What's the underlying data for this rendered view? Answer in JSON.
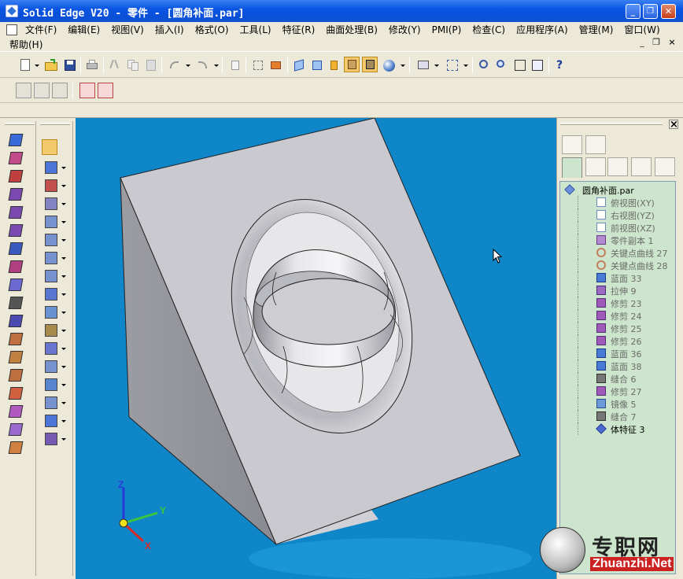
{
  "window": {
    "title": "Solid Edge V20 - 零件 - [圆角补面.par]",
    "minimize": "_",
    "restore": "❐",
    "close": "✕"
  },
  "menu": {
    "items": [
      "文件(F)",
      "编辑(E)",
      "视图(V)",
      "插入(I)",
      "格式(O)",
      "工具(L)",
      "特征(R)",
      "曲面处理(B)",
      "修改(Y)",
      "PMI(P)",
      "检查(C)",
      "应用程序(A)",
      "管理(M)",
      "窗口(W)"
    ],
    "help": "帮助(H)",
    "mdi_min": "_",
    "mdi_restore": "❐",
    "mdi_close": "×"
  },
  "toolbar_icons": [
    "new-icon",
    "open-icon",
    "save-icon",
    "print-icon",
    "cut-icon",
    "copy-icon",
    "paste-icon",
    "undo-icon",
    "redo-icon",
    "select-icon",
    "view-icons",
    "shading-icons",
    "zoom-icons",
    "whats-this-icon"
  ],
  "feature_panel": {
    "close": "×"
  },
  "tree": {
    "root": "圆角补面.par",
    "nodes": [
      {
        "label": "俯视图(XY)",
        "icon": "plane-icon"
      },
      {
        "label": "右视图(YZ)",
        "icon": "plane-icon"
      },
      {
        "label": "前视图(XZ)",
        "icon": "plane-icon"
      },
      {
        "label": "零件副本 1",
        "icon": "part-copy-icon"
      },
      {
        "label": "关键点曲线 27",
        "icon": "keypoint-curve-icon"
      },
      {
        "label": "关键点曲线 28",
        "icon": "keypoint-curve-icon"
      },
      {
        "label": "蓝面 33",
        "icon": "bluesurf-icon"
      },
      {
        "label": "拉伸 9",
        "icon": "extrude-icon"
      },
      {
        "label": "修剪 23",
        "icon": "trim-icon"
      },
      {
        "label": "修剪 24",
        "icon": "trim-icon"
      },
      {
        "label": "修剪 25",
        "icon": "trim-icon"
      },
      {
        "label": "修剪 26",
        "icon": "trim-icon"
      },
      {
        "label": "蓝面 36",
        "icon": "bluesurf-icon"
      },
      {
        "label": "蓝面 38",
        "icon": "bluesurf-icon"
      },
      {
        "label": "缝合 6",
        "icon": "stitch-icon"
      },
      {
        "label": "修剪 27",
        "icon": "trim-icon"
      },
      {
        "label": "镜像 5",
        "icon": "mirror-icon"
      },
      {
        "label": "缝合 7",
        "icon": "stitch-icon"
      },
      {
        "label": "体特征 3",
        "icon": "body-icon",
        "active": true
      }
    ]
  },
  "triad": {
    "z": "Z",
    "y": "Y",
    "x": "X"
  },
  "watermark": {
    "cn": "专职网",
    "en": "Zhuanzhi.Net"
  },
  "colors": {
    "title_bar": "#0b55e3",
    "viewport": "#0f86c8",
    "tree_bg": "#cce5cc",
    "part_face": "#c9c9cf",
    "axis_z": "#2a3ad8",
    "axis_y": "#3cc83c",
    "axis_x": "#d82a2a"
  }
}
